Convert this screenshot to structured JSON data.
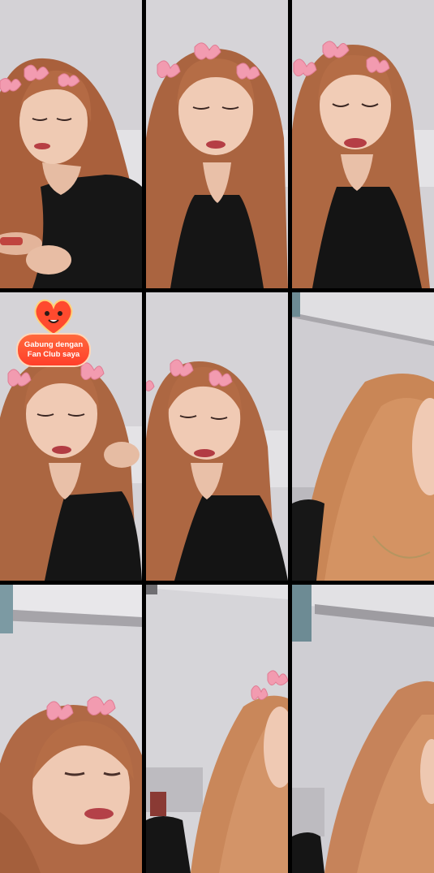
{
  "grid": {
    "columns": 3,
    "rows": 3
  },
  "tiles": [
    {
      "id": 1,
      "scene": "woman-butterfly-filter-looking-down-phone"
    },
    {
      "id": 2,
      "scene": "woman-butterfly-filter-eyes-closed"
    },
    {
      "id": 3,
      "scene": "woman-butterfly-filter-talking"
    },
    {
      "id": 4,
      "scene": "woman-with-fan-club-sticker"
    },
    {
      "id": 5,
      "scene": "woman-butterfly-filter-tilted-head"
    },
    {
      "id": 6,
      "scene": "woman-profile-turned-away"
    },
    {
      "id": 7,
      "scene": "woman-blurred-close-up"
    },
    {
      "id": 8,
      "scene": "woman-partial-face-cropped-right"
    },
    {
      "id": 9,
      "scene": "woman-hair-close-up-ceiling"
    }
  ],
  "fan_club_sticker": {
    "line1": "Gabung dengan",
    "line2": "Fan Club saya"
  },
  "colors": {
    "hair": "#b36a45",
    "hair_light": "#d8956a",
    "skin": "#edc7b0",
    "top": "#141414",
    "wall": "#d2d0d4",
    "butterfly": "#f29bb0",
    "sticker_red": "#ff4a2e"
  }
}
